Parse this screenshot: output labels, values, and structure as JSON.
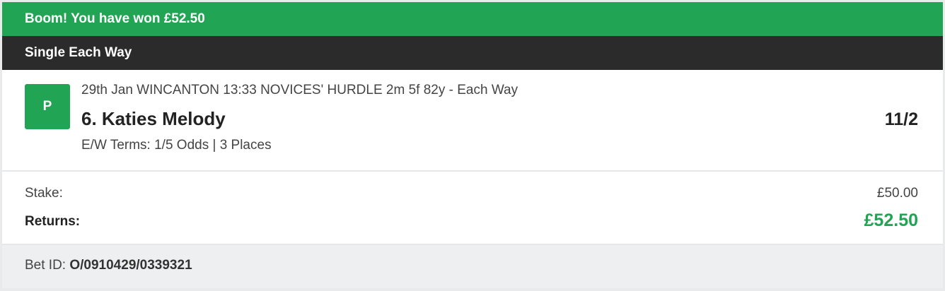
{
  "banner": {
    "win_message": "Boom! You have won £52.50",
    "bet_type": "Single Each Way"
  },
  "selection": {
    "status": "P",
    "event": "29th Jan WINCANTON 13:33 NOVICES' HURDLE 2m 5f 82y - Each Way",
    "runner": "6. Katies Melody",
    "odds": "11/2",
    "ew_terms": "E/W Terms: 1/5 Odds | 3 Places"
  },
  "totals": {
    "stake_label": "Stake:",
    "stake_value": "£50.00",
    "returns_label": "Returns:",
    "returns_value": "£52.50"
  },
  "footer": {
    "bet_id_label": "Bet ID:",
    "bet_id_value": "O/0910429/0339321"
  },
  "colors": {
    "win_green": "#21a453",
    "header_dark": "#2b2b2b",
    "footer_grey": "#eeeff0"
  }
}
